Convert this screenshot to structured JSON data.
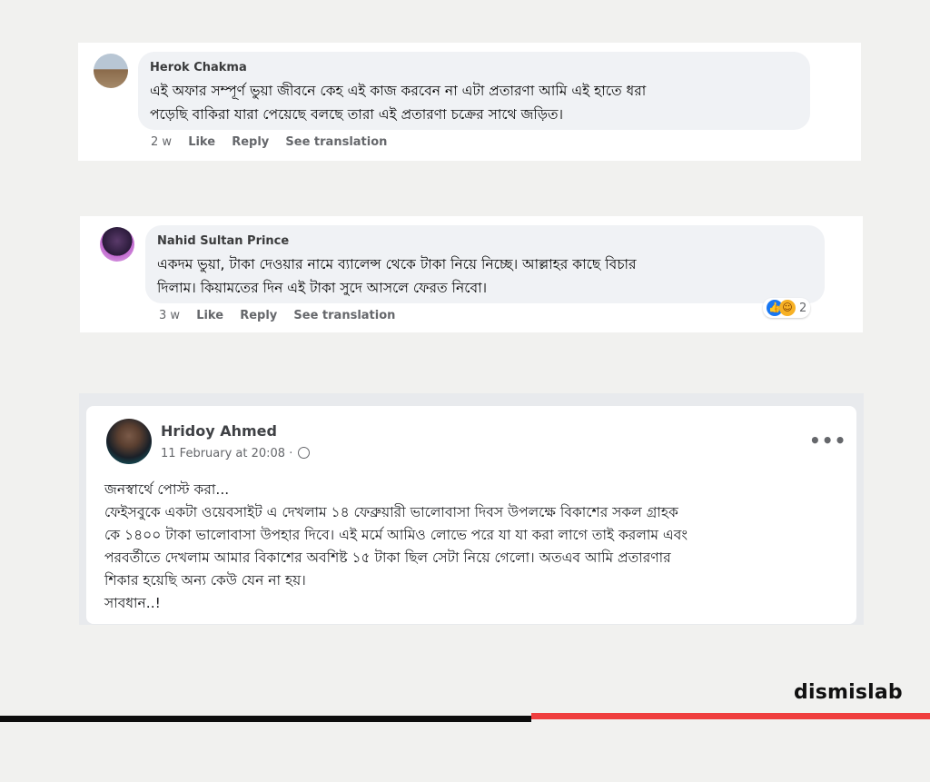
{
  "comments": [
    {
      "author": "Herok Chakma",
      "line1": "এই অফার সম্পূর্ণ ভুয়া জীবনে কেহ এই কাজ করবেন না এটা প্রতারণা আমি এই হাতে ধরা",
      "line2": "পড়েছি বাকিরা যারা পেয়েছে বলছে তারা এই প্রতারণা চক্রের সাথে জড়িত।",
      "time": "2 w",
      "like": "Like",
      "reply": "Reply",
      "translate": "See translation"
    },
    {
      "author": "Nahid Sultan Prince",
      "line1": "একদম ভুয়া, টাকা দেওয়ার নামে ব্যালেন্স থেকে টাকা নিয়ে নিচ্ছে। আল্লাহর কাছে বিচার",
      "line2": "দিলাম। কিয়ামতের দিন এই টাকা সুদে আসলে ফেরত নিবো।",
      "time": "3 w",
      "like": "Like",
      "reply": "Reply",
      "translate": "See translation",
      "reaction_count": "2"
    }
  ],
  "post": {
    "author": "Hridoy Ahmed",
    "date": "11 February at 20:08 ·",
    "globe_icon": "globe-icon",
    "more_icon": "more-options-icon",
    "lines": [
      "জনস্বার্থে পোস্ট করা...",
      "ফেইসবুকে একটা ওয়েবসাইট এ দেখলাম ১৪ ফেব্রুয়ারী ভালোবাসা দিবস উপলক্ষে বিকাশের সকল গ্রাহক",
      "কে ১৪০০ টাকা ভালোবাসা উপহার দিবে। এই মর্মে আমিও লোভে পরে যা যা করা লাগে তাই করলাম এবং",
      "পরবর্তীতে দেখলাম আমার বিকাশের অবশিষ্ট ১৫ টাকা ছিল সেটা নিয়ে গেলো। অতএব আমি প্রতারণার",
      "শিকার হয়েছি অন্য কেউ যেন না হয়।",
      "সাবধান..!"
    ]
  },
  "brand": "dismislab",
  "colors": {
    "accent_red": "#ef3e3e",
    "fb_blue": "#1877f2"
  }
}
